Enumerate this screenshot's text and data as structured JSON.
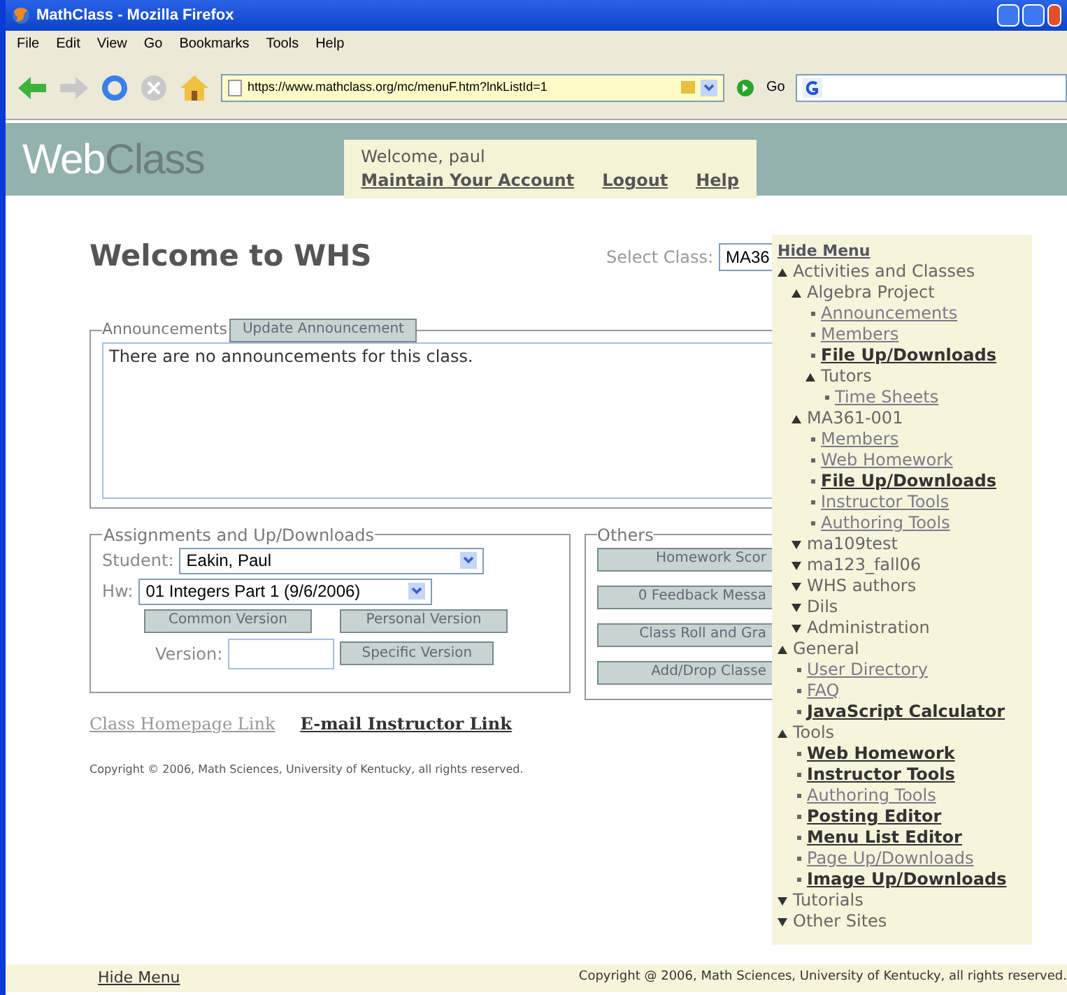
{
  "window": {
    "title": "MathClass - Mozilla Firefox"
  },
  "menubar": [
    "File",
    "Edit",
    "View",
    "Go",
    "Bookmarks",
    "Tools",
    "Help"
  ],
  "toolbar": {
    "url": "https://www.mathclass.org/mc/menuF.htm?lnkListId=1",
    "go": "Go"
  },
  "header": {
    "logo_part1": "Web",
    "logo_part2": "Class",
    "welcome": "Welcome,",
    "user": "paul",
    "links": [
      "Maintain Your Account",
      "Logout",
      "Help"
    ]
  },
  "page": {
    "title": "Welcome to WHS",
    "select_label": "Select Class:",
    "select_value": "MA36",
    "announcements": {
      "legend": "Announcements",
      "button": "Update Announcement",
      "text": "There are no announcements for this class."
    },
    "assignments": {
      "legend": "Assignments and Up/Downloads",
      "student_label": "Student:",
      "student": "Eakin, Paul",
      "hw_label": "Hw:",
      "hw": "01 Integers Part 1 (9/6/2006)",
      "buttons": [
        "Common Version",
        "Personal Version"
      ],
      "version_label": "Version:",
      "version_button": "Specific Version"
    },
    "others": {
      "legend": "Others",
      "buttons": [
        "Homework Scor",
        "0 Feedback Messa",
        "Class Roll and Gra",
        "Add/Drop Classe"
      ]
    },
    "links": [
      {
        "label": "Class Homepage Link",
        "bold": false
      },
      {
        "label": "E-mail Instructor Link",
        "bold": true
      }
    ],
    "copyright": "Copyright © 2006, Math Sciences, University of Kentucky, all rights reserved."
  },
  "side_menu": {
    "hide": "Hide Menu",
    "items": [
      {
        "kind": "group",
        "label": "Activities and Classes",
        "expanded": true,
        "children": [
          {
            "kind": "group",
            "label": "Algebra Project",
            "expanded": true,
            "children": [
              {
                "kind": "link",
                "label": "Announcements",
                "bold": false
              },
              {
                "kind": "link",
                "label": "Members",
                "bold": false
              },
              {
                "kind": "link",
                "label": "File Up/Downloads",
                "bold": true
              },
              {
                "kind": "group",
                "label": "Tutors",
                "expanded": true,
                "children": [
                  {
                    "kind": "link",
                    "label": "Time Sheets",
                    "bold": false
                  }
                ]
              }
            ]
          },
          {
            "kind": "group",
            "label": "MA361-001",
            "expanded": true,
            "children": [
              {
                "kind": "link",
                "label": "Members",
                "bold": false
              },
              {
                "kind": "link",
                "label": "Web Homework",
                "bold": false
              },
              {
                "kind": "link",
                "label": "File Up/Downloads",
                "bold": true
              },
              {
                "kind": "link",
                "label": "Instructor Tools",
                "bold": false
              },
              {
                "kind": "link",
                "label": "Authoring Tools",
                "bold": false
              }
            ]
          },
          {
            "kind": "group",
            "label": "ma109test",
            "expanded": false
          },
          {
            "kind": "group",
            "label": "ma123_fall06",
            "expanded": false
          },
          {
            "kind": "group",
            "label": "WHS authors",
            "expanded": false
          },
          {
            "kind": "group",
            "label": "Dils",
            "expanded": false
          },
          {
            "kind": "group",
            "label": "Administration",
            "expanded": false
          }
        ]
      },
      {
        "kind": "group",
        "label": "General",
        "expanded": true,
        "children": [
          {
            "kind": "link",
            "label": "User Directory",
            "bold": false
          },
          {
            "kind": "link",
            "label": "FAQ",
            "bold": false
          },
          {
            "kind": "link",
            "label": "JavaScript Calculator",
            "bold": true
          }
        ]
      },
      {
        "kind": "group",
        "label": "Tools",
        "expanded": true,
        "children": [
          {
            "kind": "link",
            "label": "Web Homework",
            "bold": true
          },
          {
            "kind": "link",
            "label": "Instructor Tools",
            "bold": true
          },
          {
            "kind": "link",
            "label": "Authoring Tools",
            "bold": false
          },
          {
            "kind": "link",
            "label": "Posting Editor",
            "bold": true
          },
          {
            "kind": "link",
            "label": "Menu List Editor",
            "bold": true
          },
          {
            "kind": "link",
            "label": "Page Up/Downloads",
            "bold": false
          },
          {
            "kind": "link",
            "label": "Image Up/Downloads",
            "bold": true
          }
        ]
      },
      {
        "kind": "group",
        "label": "Tutorials",
        "expanded": false
      },
      {
        "kind": "group",
        "label": "Other Sites",
        "expanded": false
      }
    ]
  },
  "footer": {
    "hide": "Hide Menu",
    "copyright": "Copyright @ 2006, Math Sciences, University of Kentucky, all rights reserved."
  }
}
